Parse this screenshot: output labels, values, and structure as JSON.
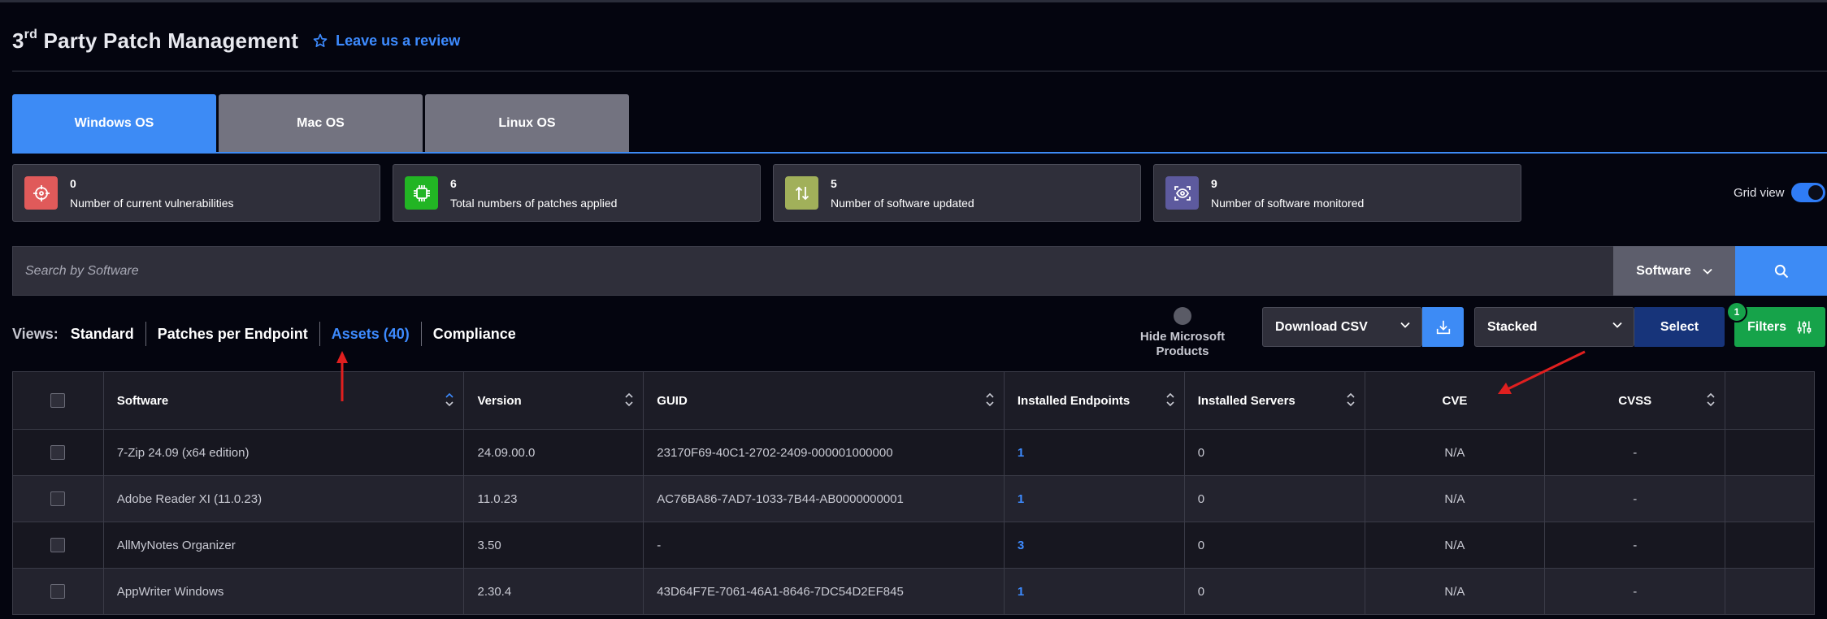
{
  "header": {
    "title_prefix": "3",
    "title_sup": "rd",
    "title_rest": " Party Patch Management",
    "review_label": "Leave us a review"
  },
  "os_tabs": [
    {
      "label": "Windows OS",
      "active": true
    },
    {
      "label": "Mac OS",
      "active": false
    },
    {
      "label": "Linux OS",
      "active": false
    }
  ],
  "stats": [
    {
      "value": "0",
      "label": "Number of current vulnerabilities",
      "icon": "crosshair-icon",
      "color": "#e05a5a"
    },
    {
      "value": "6",
      "label": "Total numbers of patches applied",
      "icon": "chip-icon",
      "color": "#22b524"
    },
    {
      "value": "5",
      "label": "Number of software updated",
      "icon": "arrows-up-down-icon",
      "color": "#a1b05a"
    },
    {
      "value": "9",
      "label": "Number of software monitored",
      "icon": "eye-scan-icon",
      "color": "#5d5a9e"
    }
  ],
  "grid_view": {
    "label": "Grid view",
    "on": true
  },
  "search": {
    "placeholder": "Search by Software",
    "value": "",
    "type_label": "Software"
  },
  "views": {
    "label": "Views:",
    "items": [
      {
        "label": "Standard",
        "active": false
      },
      {
        "label": "Patches per Endpoint",
        "active": false
      },
      {
        "label": "Assets (40)",
        "active": true
      },
      {
        "label": "Compliance",
        "active": false
      }
    ]
  },
  "toolbar": {
    "hide_ms_label": "Hide Microsoft Products",
    "csv_label": "Download CSV",
    "layout_label": "Stacked",
    "select_label": "Select",
    "filters_label": "Filters",
    "filters_count": "1"
  },
  "table": {
    "columns": [
      "Software",
      "Version",
      "GUID",
      "Installed Endpoints",
      "Installed Servers",
      "CVE",
      "CVSS"
    ],
    "rows": [
      {
        "software": "7-Zip 24.09 (x64 edition)",
        "version": "24.09.00.0",
        "guid": "23170F69-40C1-2702-2409-000001000000",
        "endpoints": "1",
        "servers": "0",
        "cve": "N/A",
        "cvss": "-"
      },
      {
        "software": "Adobe Reader XI (11.0.23)",
        "version": "11.0.23",
        "guid": "AC76BA86-7AD7-1033-7B44-AB0000000001",
        "endpoints": "1",
        "servers": "0",
        "cve": "N/A",
        "cvss": "-"
      },
      {
        "software": "AllMyNotes Organizer",
        "version": "3.50",
        "guid": "-",
        "endpoints": "3",
        "servers": "0",
        "cve": "N/A",
        "cvss": "-"
      },
      {
        "software": "AppWriter Windows",
        "version": "2.30.4",
        "guid": "43D64F7E-7061-46A1-8646-7DC54D2EF845",
        "endpoints": "1",
        "servers": "0",
        "cve": "N/A",
        "cvss": "-"
      }
    ]
  },
  "colors": {
    "accent": "#3d8bf5",
    "filters": "#16a34a",
    "select": "#17347a",
    "annotation": "#e01f1f"
  }
}
